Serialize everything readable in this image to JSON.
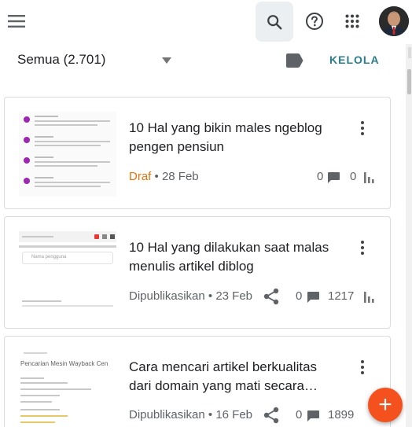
{
  "topbar": {
    "menu_icon": "hamburger-menu-icon",
    "search_icon": "search-icon",
    "help_icon": "help-circle-icon",
    "apps_icon": "apps-grid-icon",
    "avatar_icon": "user-avatar"
  },
  "filter": {
    "label": "Semua (2.701)",
    "label_icon": "label-tag-icon",
    "manage": "KELOLA"
  },
  "posts": [
    {
      "title": "10 Hal yang bikin males ngeblog pengen pensiun",
      "status": "Draf",
      "date": "28 Feb",
      "comments": "0",
      "views": "0",
      "status_color": "#e8710a"
    },
    {
      "title": "10 Hal yang dilakukan saat malas menulis artikel diblog",
      "status": "Dipublikasikan",
      "date": "23 Feb",
      "comments": "0",
      "views": "1217",
      "thumb_placeholder": "Nama pengguna"
    },
    {
      "title": "Cara mencari artikel berkualitas dari domain yang mati secara…",
      "status": "Dipublikasikan",
      "date": "16 Feb",
      "comments": "0",
      "views": "1899",
      "thumb_heading": "Pencarian Mesin Wayback Cen"
    }
  ],
  "fab": {
    "label": "+",
    "icon": "add-icon"
  },
  "colors": {
    "accent": "#2a7d8c",
    "draft": "#e8710a",
    "fab": "#f4511e"
  }
}
